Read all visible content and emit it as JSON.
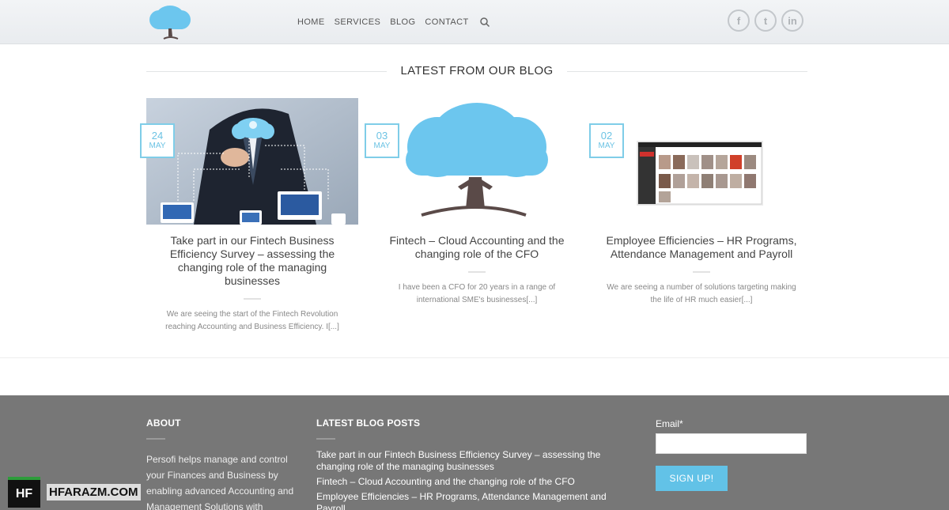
{
  "header": {
    "nav": [
      "HOME",
      "SERVICES",
      "BLOG",
      "CONTACT"
    ],
    "social": [
      {
        "icon": "facebook-icon",
        "glyph": "f"
      },
      {
        "icon": "twitter-icon",
        "glyph": "t"
      },
      {
        "icon": "linkedin-icon",
        "glyph": "in"
      }
    ]
  },
  "blog": {
    "title": "LATEST FROM OUR BLOG",
    "posts": [
      {
        "day": "24",
        "month": "MAY",
        "title": "Take part in our Fintech Business Efficiency Survey – assessing the changing role of the managing businesses",
        "excerpt": "We are seeing the start of the Fintech Revolution reaching Accounting and Business Efficiency. I[...]"
      },
      {
        "day": "03",
        "month": "MAY",
        "title": "Fintech – Cloud Accounting and the changing role of the CFO",
        "excerpt": "I have been a CFO for 20 years in a range of international SME's businesses[...]"
      },
      {
        "day": "02",
        "month": "MAY",
        "title": "Employee Efficiencies – HR Programs, Attendance Management and Payroll",
        "excerpt": "We are seeing a number of solutions targeting making the life of HR much easier[...]"
      }
    ]
  },
  "footer": {
    "about_title": "ABOUT",
    "about_text": "Persofi helps manage and control your Finances and Business by enabling advanced Accounting and Management Solutions with",
    "posts_title": "LATEST BLOG POSTS",
    "posts": [
      "Take part in our Fintech Business Efficiency Survey – assessing the changing role of the managing businesses",
      "Fintech – Cloud Accounting and the changing role of the CFO",
      "Employee Efficiencies – HR Programs, Attendance Management and Payroll"
    ],
    "email_label": "Email*",
    "signup_label": "SIGN UP!"
  },
  "watermark": {
    "mark": "HF",
    "text": "HFARAZM.COM"
  },
  "colors": {
    "accent": "#62c2e7",
    "footer_bg": "#777777",
    "tree_trunk": "#5a4a48"
  }
}
